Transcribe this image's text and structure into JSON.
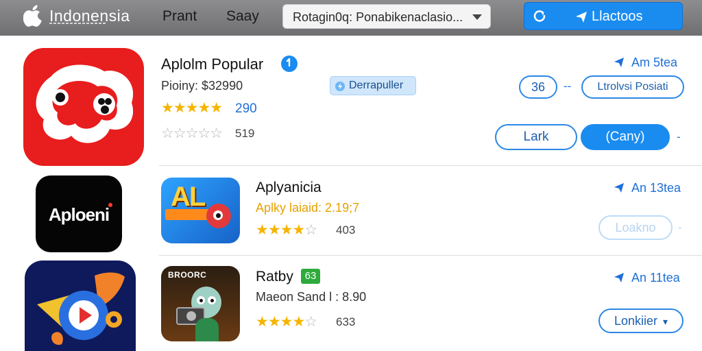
{
  "topbar": {
    "brand": "Indonensia",
    "nav": [
      "Prant",
      "Saay"
    ],
    "search": {
      "value": "Rotagin0q: Ponabikenaclasio..."
    },
    "cta_label": "Llactoos",
    "icons": {
      "logo": "apple-icon",
      "refresh": "refresh-icon",
      "send": "plane-icon"
    }
  },
  "featured": {
    "title": "Aplolm Popular",
    "price": "Pioiny: $32990",
    "rating_count": "290",
    "stars_filled": 5,
    "secondary_stars_filled": 0,
    "secondary_count": "519",
    "badge_label": "Derrapuller",
    "time": "Am 5tea",
    "count_pill": "36",
    "right_pill": "Ltrolvsi Posiati",
    "buttons": {
      "left": "Lark",
      "right": "(Cany)"
    }
  },
  "left_tiles": {
    "mid_label": "Aploeni"
  },
  "rows": [
    {
      "name": "Aplyanicia",
      "price": "Aplky laiaid: 2.19;7",
      "stars_filled": 4,
      "stars_total": 5,
      "rating_count": "403",
      "time": "An 13tea",
      "button": "Loakno",
      "icon_text": "AL"
    },
    {
      "name": "Ratby",
      "tag": "63",
      "price": "Maeon Sand l : 8.90",
      "stars_filled": 4,
      "stars_total": 5,
      "rating_count": "633",
      "time": "An 11tea",
      "button": "Lonkiier",
      "icon_text": "BROORC"
    }
  ],
  "colors": {
    "accent": "#1a8cf0",
    "star": "#f5b400",
    "red_icon": "#e81d1d",
    "tag_green": "#2faa3c"
  }
}
